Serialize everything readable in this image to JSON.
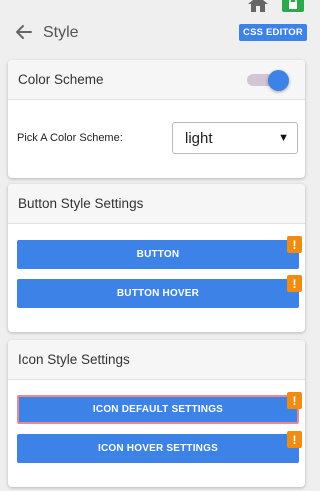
{
  "header": {
    "title": "Style",
    "css_editor_label": "CSS EDITOR",
    "icons": {
      "home": "home-icon",
      "lock": "lock-icon",
      "back": "arrow-left-icon"
    }
  },
  "color_scheme": {
    "title": "Color Scheme",
    "toggle_on": true,
    "pick_label": "Pick A Color Scheme:",
    "selected": "light"
  },
  "button_style": {
    "title": "Button Style Settings",
    "buttons": [
      "BUTTON",
      "BUTTON HOVER"
    ]
  },
  "icon_style": {
    "title": "Icon Style Settings",
    "buttons": [
      "ICON DEFAULT SETTINGS",
      "ICON HOVER SETTINGS"
    ]
  },
  "warning_symbol": "!",
  "colors": {
    "accent": "#3d82e6",
    "warning": "#f28b12",
    "lock_badge": "#2ea84a",
    "toggle_track": "#d3c4d6",
    "selected_outline": "#e88a92"
  }
}
